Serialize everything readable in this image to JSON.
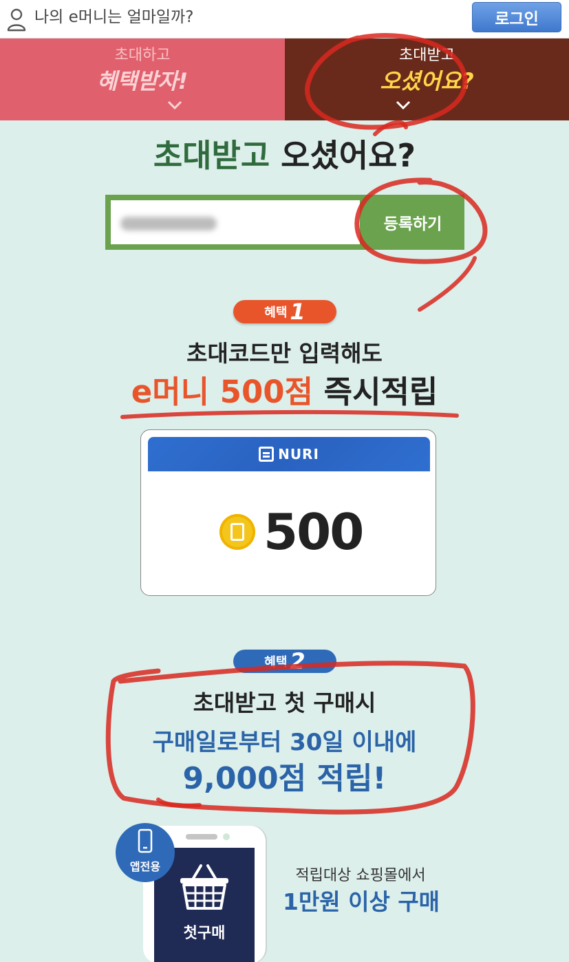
{
  "header": {
    "emoney_question": "나의 e머니는 얼마일까?",
    "login_label": "로그인"
  },
  "tabs": [
    {
      "sub": "초대하고",
      "main": "혜택받자!"
    },
    {
      "sub": "초대받고",
      "main": "오셨어요?"
    }
  ],
  "page_title": {
    "highlight": "초대받고",
    "rest": " 오셨어요?"
  },
  "invite": {
    "register_label": "등록하기"
  },
  "benefit1": {
    "badge_text": "혜택",
    "badge_num": "1",
    "line1": "초대코드만 입력해도",
    "highlight": "e머니 500점",
    "rest": " 즉시적립",
    "card_brand": "NURI",
    "card_value": "500"
  },
  "benefit2": {
    "badge_text": "혜택",
    "badge_num": "2",
    "line1": "초대받고 첫 구매시",
    "line2": "구매일로부터 30일 이내에",
    "line3": "9,000점 적립!",
    "app_only": "앱전용",
    "first_purchase": "첫구매",
    "cond1": "적립대상 쇼핑몰에서",
    "cond2": "1만원 이상 구매"
  },
  "colors": {
    "tab1_bg": "#e0616d",
    "tab2_bg": "#6a2a1b",
    "accent_green": "#6aa24d",
    "accent_orange": "#e8552b",
    "accent_blue": "#2a63a8",
    "annotation_red": "#d8281e"
  }
}
